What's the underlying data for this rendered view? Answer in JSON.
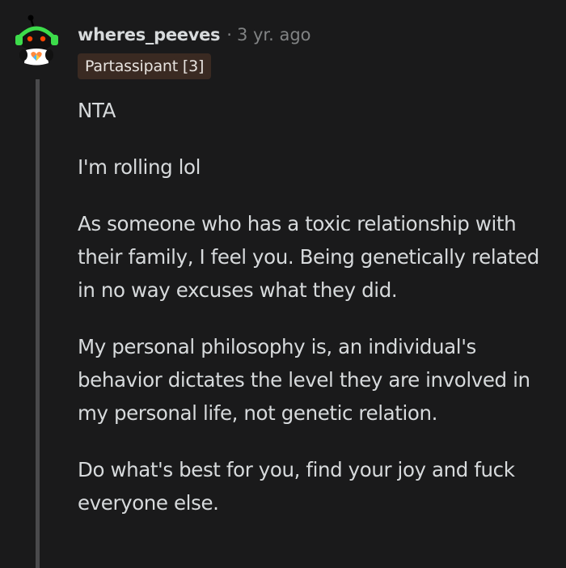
{
  "comment": {
    "username": "wheres_peeves",
    "separator": "·",
    "timestamp": "3 yr. ago",
    "flair": "Partassipant [3]",
    "paragraphs": [
      "NTA",
      "I'm rolling lol",
      "As someone who has a toxic relationship with their family, I feel you. Being genetically related in no way excuses what they did.",
      "My personal philosophy is, an individual's behavior dictates the level they are involved in my personal life, not genetic relation.",
      "Do what's best for you, find your joy and fuck everyone else."
    ]
  },
  "colors": {
    "background": "#1a1a1b",
    "text": "#d7dadc",
    "meta": "#818384",
    "flair_bg": "#3a2a22",
    "thread_line": "#4a4a4c",
    "avatar_accent": "#3ddc4b"
  },
  "icons": {
    "avatar": "snoo-avatar-icon"
  }
}
